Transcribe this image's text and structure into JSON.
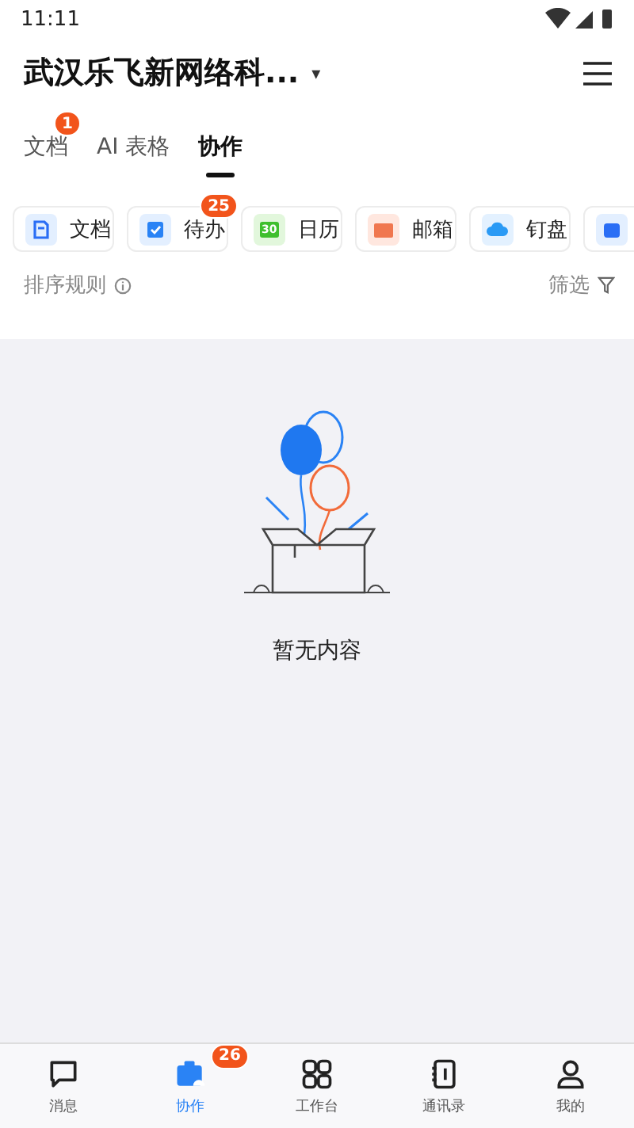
{
  "status_bar": {
    "time": "11:11"
  },
  "header": {
    "title": "武汉乐飞新网络科...",
    "dropdown_glyph": "▾"
  },
  "tabs": [
    {
      "label": "文档",
      "selected": false,
      "badge": "1"
    },
    {
      "label": "AI 表格",
      "selected": false
    },
    {
      "label": "协作",
      "selected": true
    }
  ],
  "shortcuts": [
    {
      "kind": "doc",
      "label": "文档"
    },
    {
      "kind": "todo",
      "label": "待办",
      "badge": "25"
    },
    {
      "kind": "calendar",
      "label": "日历",
      "icon_text": "30"
    },
    {
      "kind": "mail",
      "label": "邮箱"
    },
    {
      "kind": "drive",
      "label": "钉盘"
    },
    {
      "kind": "video"
    }
  ],
  "sort": {
    "label": "排序规则",
    "filter": "筛选"
  },
  "empty": {
    "message": "暂无内容"
  },
  "bottom_nav": [
    {
      "kind": "chat",
      "label": "消息",
      "selected": false
    },
    {
      "kind": "collab",
      "label": "协作",
      "selected": true,
      "badge": "26"
    },
    {
      "kind": "grid",
      "label": "工作台",
      "selected": false
    },
    {
      "kind": "contacts",
      "label": "通讯录",
      "selected": false
    },
    {
      "kind": "person",
      "label": "我的",
      "selected": false
    }
  ]
}
